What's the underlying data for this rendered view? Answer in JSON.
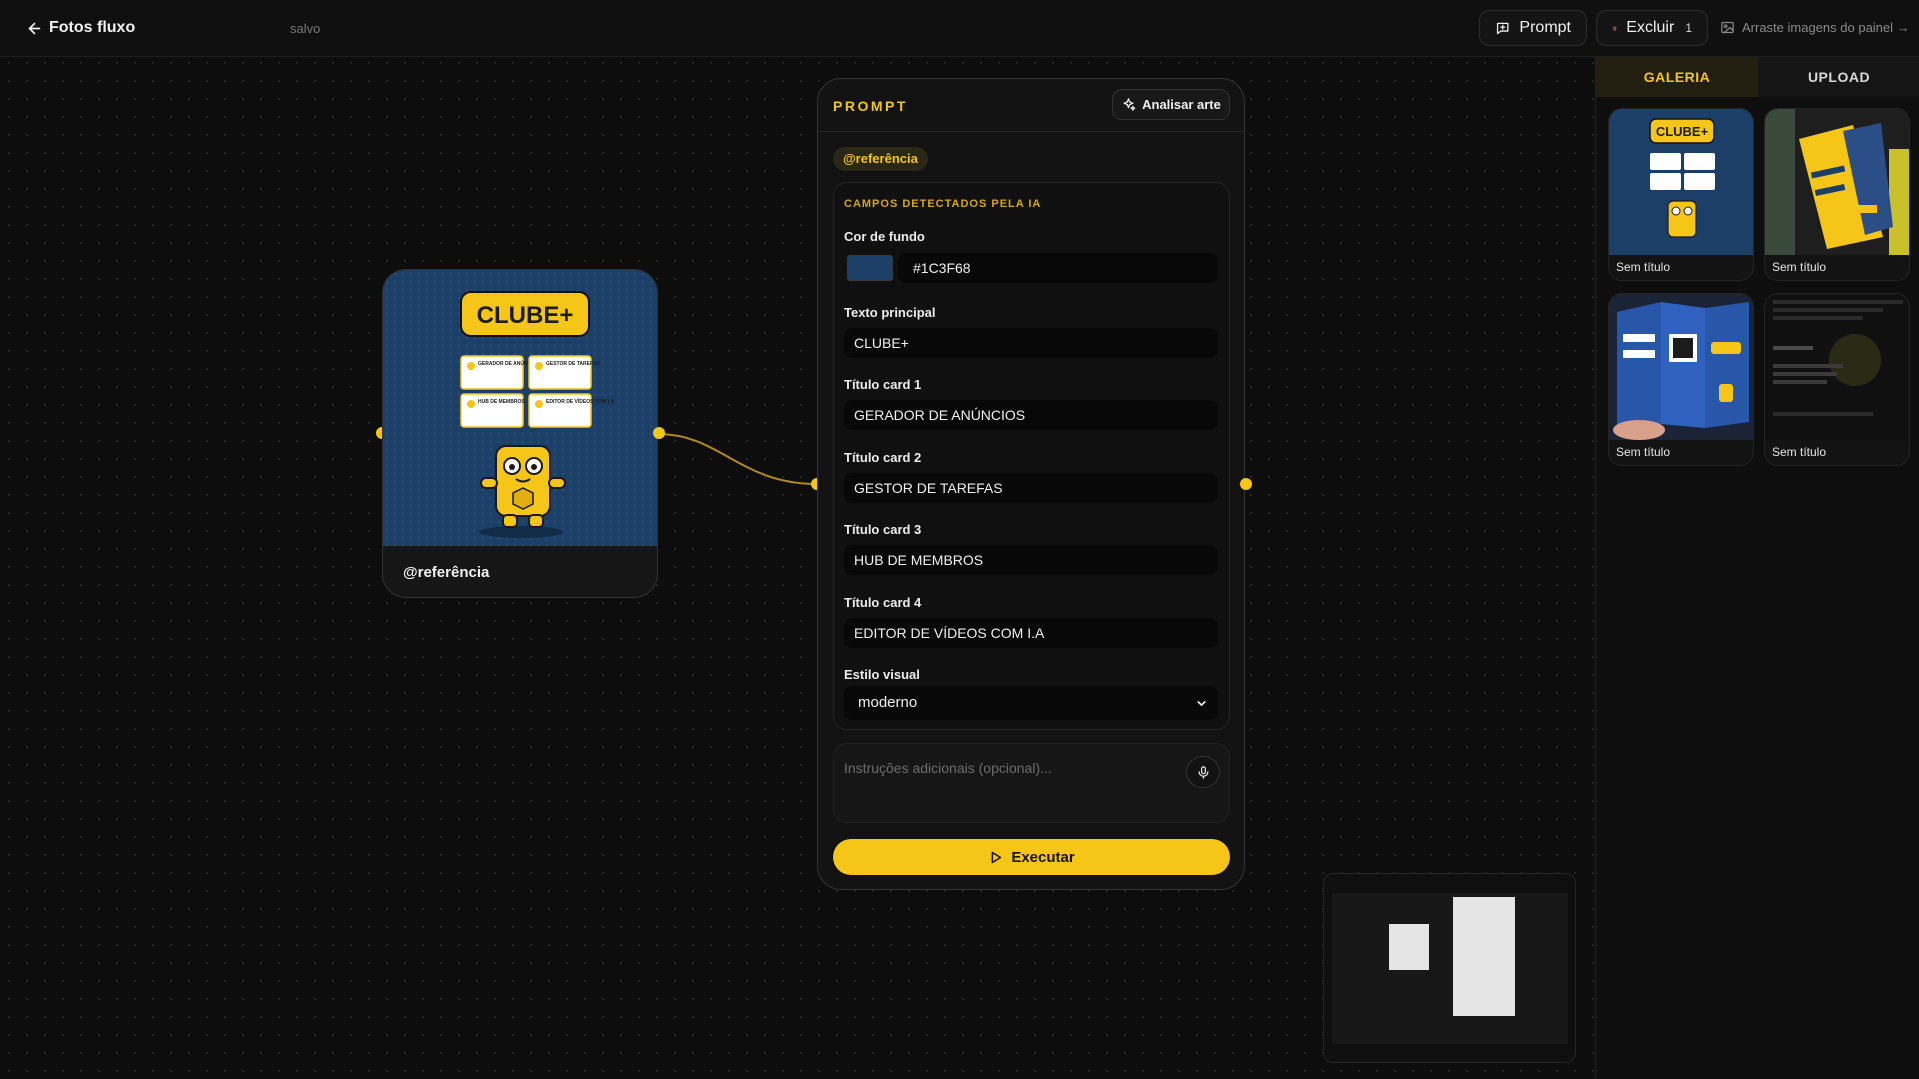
{
  "header": {
    "back_label": "Fotos fluxo",
    "saved_status": "salvo",
    "prompt_button": "Prompt",
    "delete_button": "Excluir",
    "delete_count": "1",
    "drag_hint": "Arraste imagens do painel →"
  },
  "reference_node": {
    "label": "@referência",
    "image": {
      "brand_text": "CLUBE+",
      "cards": [
        "GERADOR DE ANÚNCIOS",
        "GESTOR DE TAREFAS",
        "HUB DE MEMBROS",
        "EDITOR DE VÍDEOS COM I.A"
      ]
    }
  },
  "prompt_node": {
    "title": "PROMPT",
    "analyze_button": "Analisar arte",
    "reference_tag": "@referência",
    "fields_title": "CAMPOS DETECTADOS PELA IA",
    "fields": {
      "background_color": {
        "label": "Cor de fundo",
        "value": "#1C3F68"
      },
      "main_text": {
        "label": "Texto principal",
        "value": "CLUBE+"
      },
      "card1": {
        "label": "Título card 1",
        "value": "GERADOR DE ANÚNCIOS"
      },
      "card2": {
        "label": "Título card 2",
        "value": "GESTOR DE TAREFAS"
      },
      "card3": {
        "label": "Título card 3",
        "value": "HUB DE MEMBROS"
      },
      "card4": {
        "label": "Título card 4",
        "value": "EDITOR DE VÍDEOS COM I.A"
      },
      "visual_style": {
        "label": "Estilo visual",
        "value": "moderno"
      }
    },
    "instructions_placeholder": "Instruções adicionais (opcional)...",
    "run_button": "Executar"
  },
  "side_panel": {
    "tabs": [
      "GALERIA",
      "UPLOAD"
    ],
    "active_tab": "GALERIA",
    "items": [
      {
        "caption": "Sem título",
        "thumb": "clube-poster"
      },
      {
        "caption": "Sem título",
        "thumb": "printed-flyer"
      },
      {
        "caption": "Sem título",
        "thumb": "folded-brochure"
      },
      {
        "caption": "Sem título",
        "thumb": "dark-text-document"
      }
    ]
  },
  "icons": {
    "back": "arrow-left-icon",
    "prompt": "message-plus-icon",
    "delete": "trash-icon",
    "drag": "image-icon",
    "analyze": "sparkles-icon",
    "mic": "microphone-icon",
    "select": "chevron-down-icon",
    "run": "play-icon"
  },
  "colors": {
    "accent": "#f5c518",
    "background": "#0d0d0d",
    "swatch": "#1C3F68"
  }
}
